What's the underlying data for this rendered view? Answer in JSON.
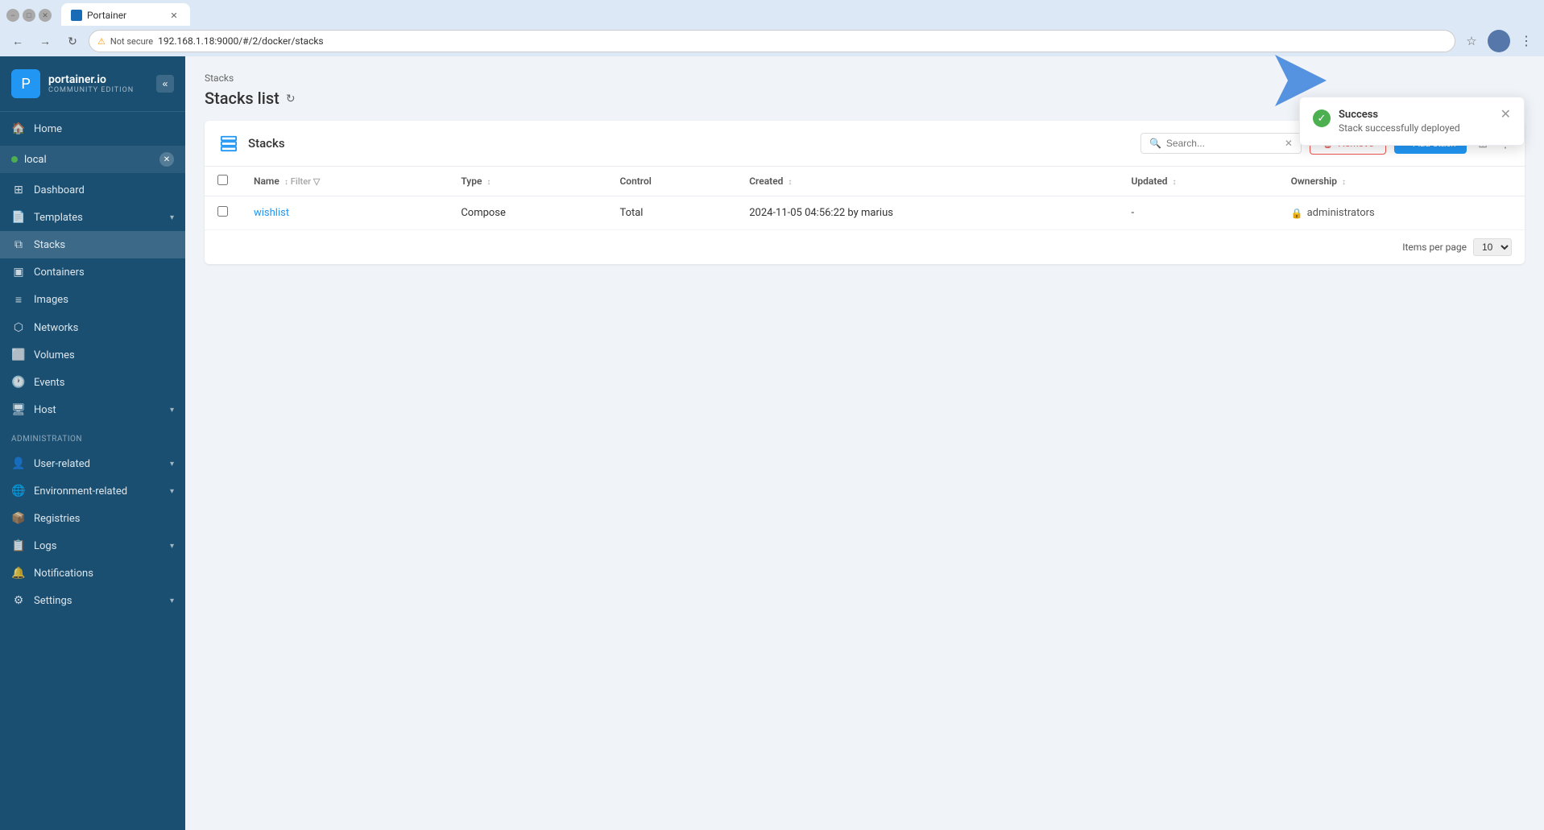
{
  "browser": {
    "tab_label": "Portainer",
    "url": "192.168.1.18:9000/#/2/docker/stacks",
    "security_label": "Not secure"
  },
  "sidebar": {
    "logo_name": "portainer.io",
    "logo_sub": "COMMUNITY EDITION",
    "collapse_label": "«",
    "env_name": "local",
    "items": [
      {
        "id": "home",
        "label": "Home",
        "icon": "🏠"
      },
      {
        "id": "dashboard",
        "label": "Dashboard",
        "icon": "⊞"
      },
      {
        "id": "templates",
        "label": "Templates",
        "icon": "📄",
        "chevron": "▾"
      },
      {
        "id": "stacks",
        "label": "Stacks",
        "icon": "⧉"
      },
      {
        "id": "containers",
        "label": "Containers",
        "icon": "▣"
      },
      {
        "id": "images",
        "label": "Images",
        "icon": "≡"
      },
      {
        "id": "networks",
        "label": "Networks",
        "icon": "⬡"
      },
      {
        "id": "volumes",
        "label": "Volumes",
        "icon": "⬜"
      },
      {
        "id": "events",
        "label": "Events",
        "icon": "🕐"
      },
      {
        "id": "host",
        "label": "Host",
        "icon": "🖥",
        "chevron": "▾"
      }
    ],
    "admin_label": "Administration",
    "admin_items": [
      {
        "id": "user-related",
        "label": "User-related",
        "icon": "👤",
        "chevron": "▾"
      },
      {
        "id": "environment-related",
        "label": "Environment-related",
        "icon": "🌐",
        "chevron": "▾"
      },
      {
        "id": "registries",
        "label": "Registries",
        "icon": "📦"
      },
      {
        "id": "logs",
        "label": "Logs",
        "icon": "📋",
        "chevron": "▾"
      },
      {
        "id": "notifications",
        "label": "Notifications",
        "icon": "🔔"
      },
      {
        "id": "settings",
        "label": "Settings",
        "icon": "⚙",
        "chevron": "▾"
      }
    ]
  },
  "page": {
    "breadcrumb": "Stacks",
    "title": "Stacks list"
  },
  "stacks_card": {
    "title": "Stacks",
    "search_placeholder": "Search...",
    "remove_label": "Remove",
    "add_label": "+ Add stack",
    "columns": {
      "name": "Name",
      "filter": "Filter",
      "type": "Type",
      "control": "Control",
      "created": "Created",
      "updated": "Updated",
      "ownership": "Ownership"
    },
    "rows": [
      {
        "name": "wishlist",
        "type": "Compose",
        "control": "Total",
        "created": "2024-11-05 04:56:22 by marius",
        "updated": "-",
        "ownership": "administrators"
      }
    ],
    "pagination": {
      "items_per_page_label": "Items per page",
      "per_page_value": "10"
    }
  },
  "notification": {
    "title": "Success",
    "message": "Stack successfully deployed"
  }
}
